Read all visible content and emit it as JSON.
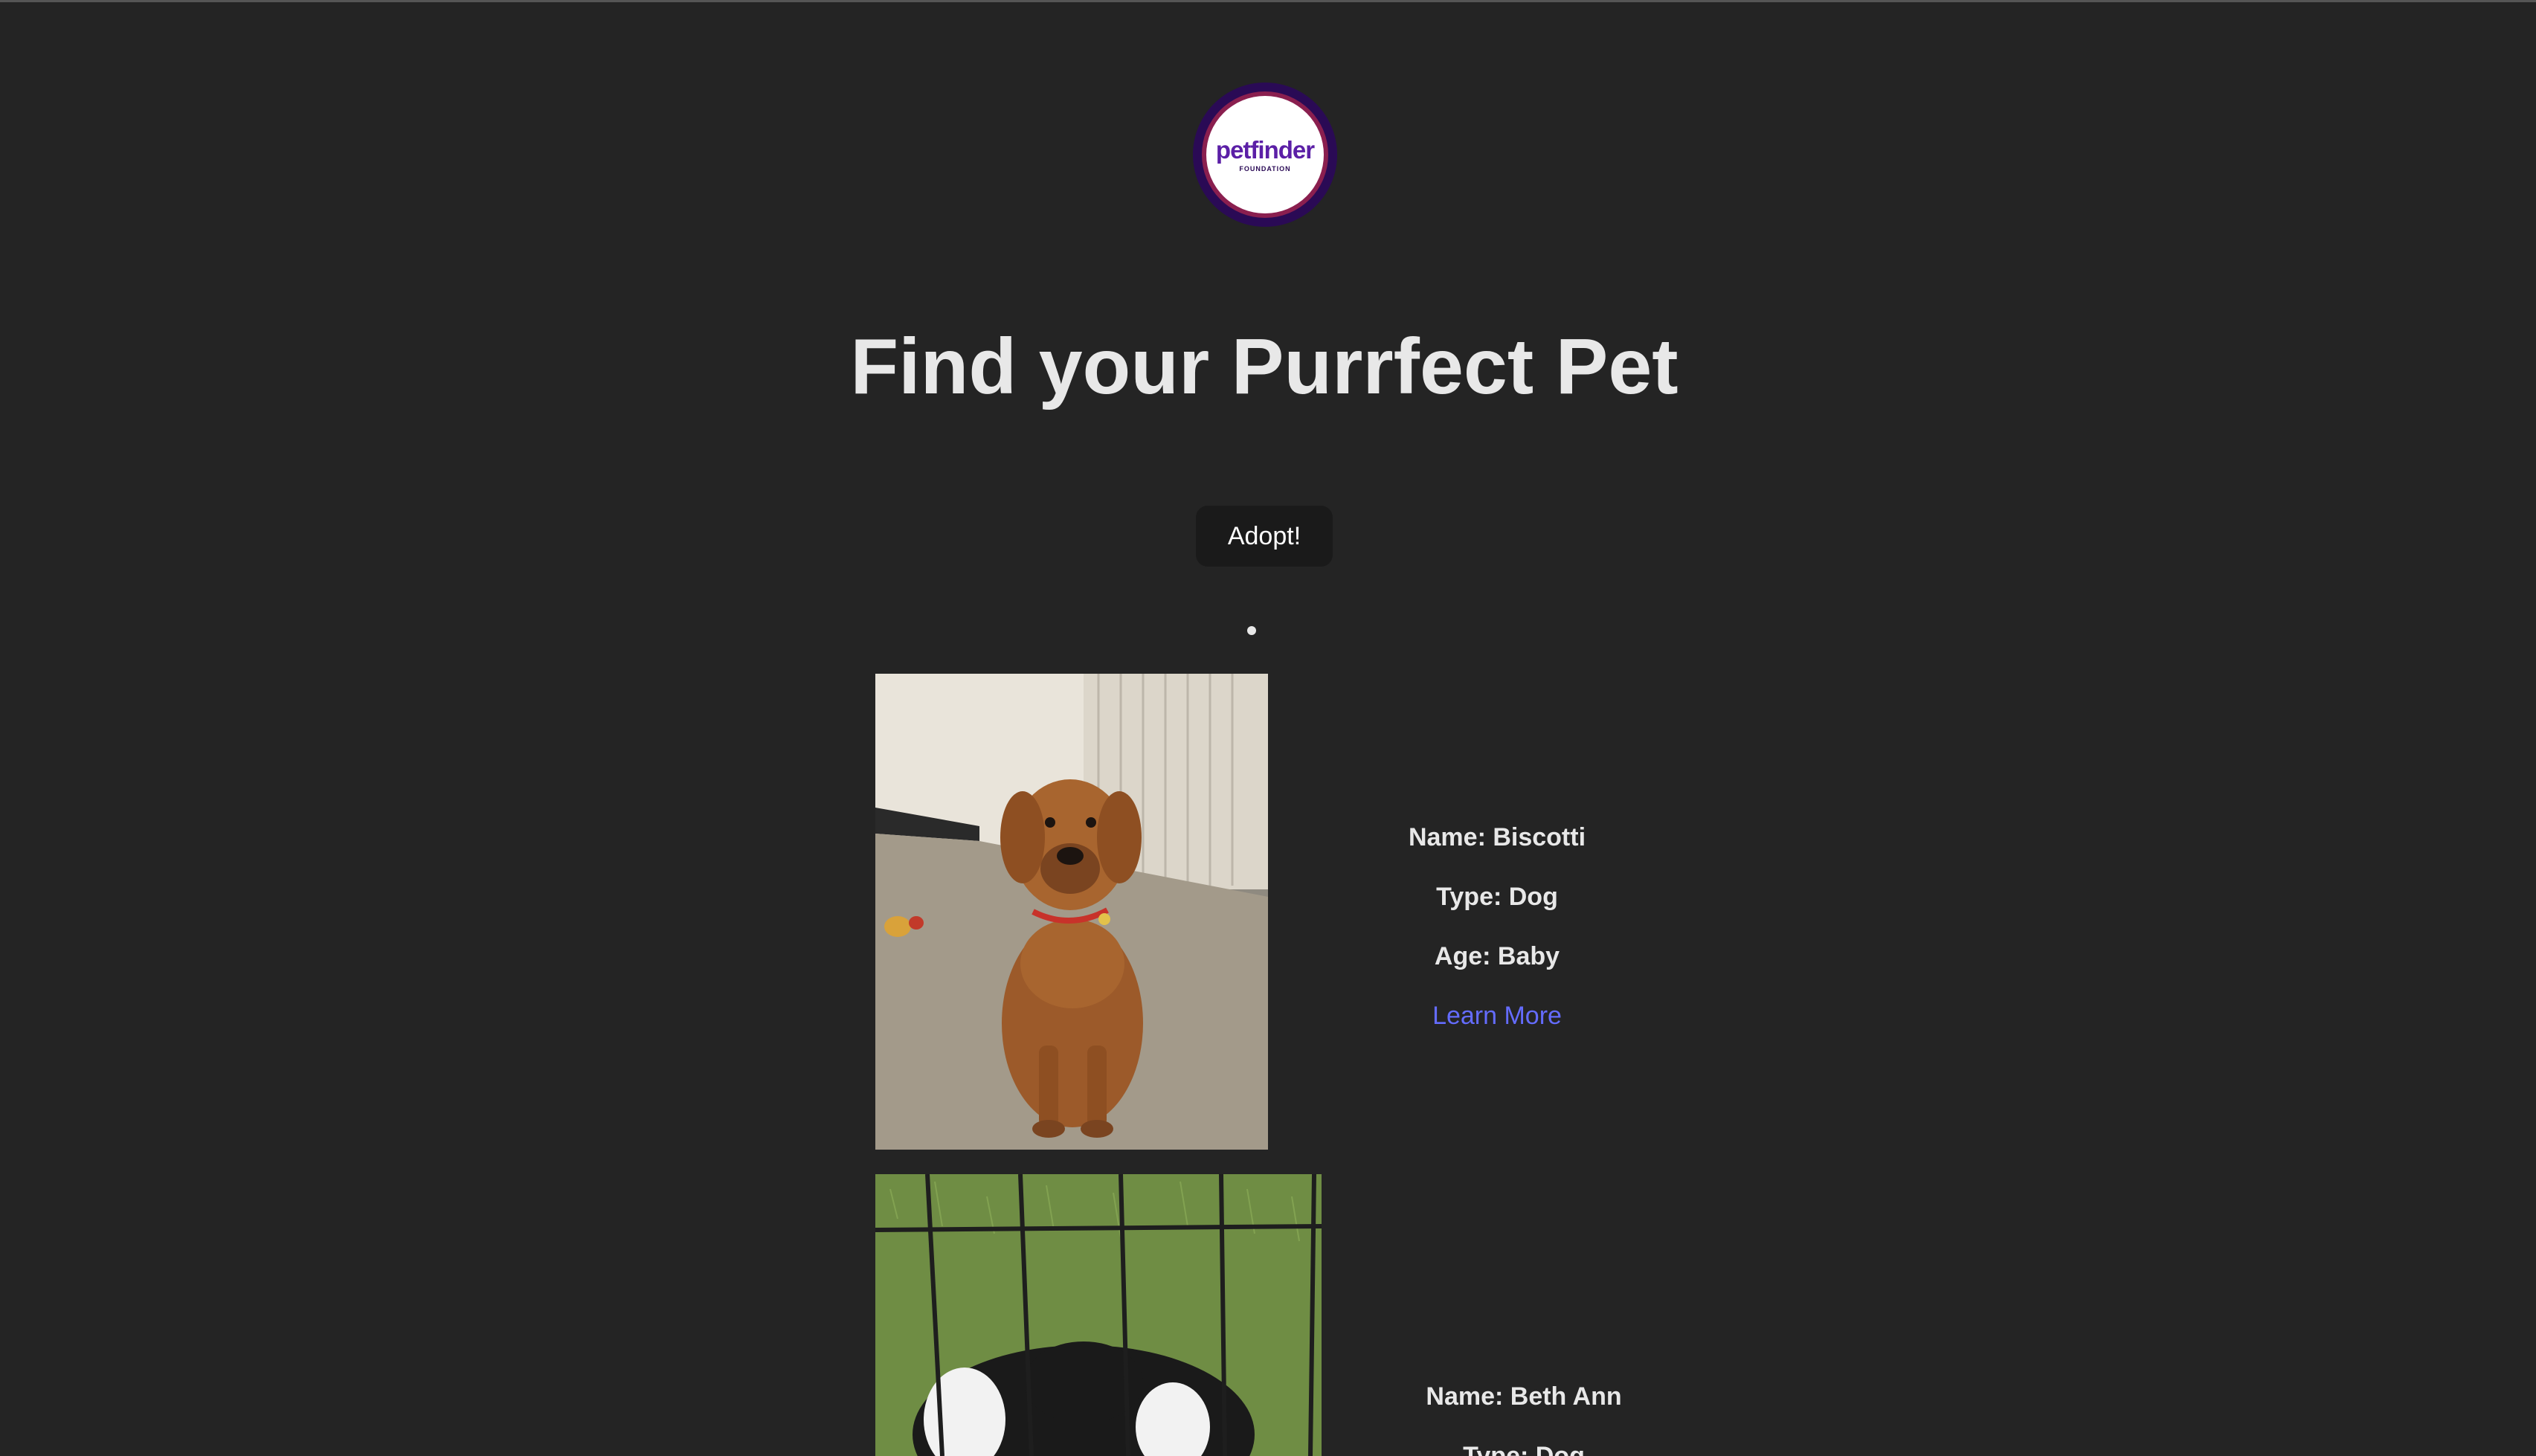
{
  "header": {
    "logo": {
      "word": "petfinder",
      "sub": "FOUNDATION"
    },
    "title": "Find your Purrfect Pet",
    "adopt_label": "Adopt!"
  },
  "pets": [
    {
      "name": "Name: Biscotti",
      "type": "Type: Dog",
      "age": "Age: Baby",
      "link": "Learn More",
      "photo": "tan-puppy-photo"
    },
    {
      "name": "Name: Beth Ann",
      "type": "Type: Dog",
      "photo": "black-white-dog-photo"
    }
  ],
  "colors": {
    "background": "#242424",
    "text": "#e8e8e8",
    "link": "#646cff",
    "button": "#1a1a1a",
    "logo_purple": "#5b1fa6"
  }
}
